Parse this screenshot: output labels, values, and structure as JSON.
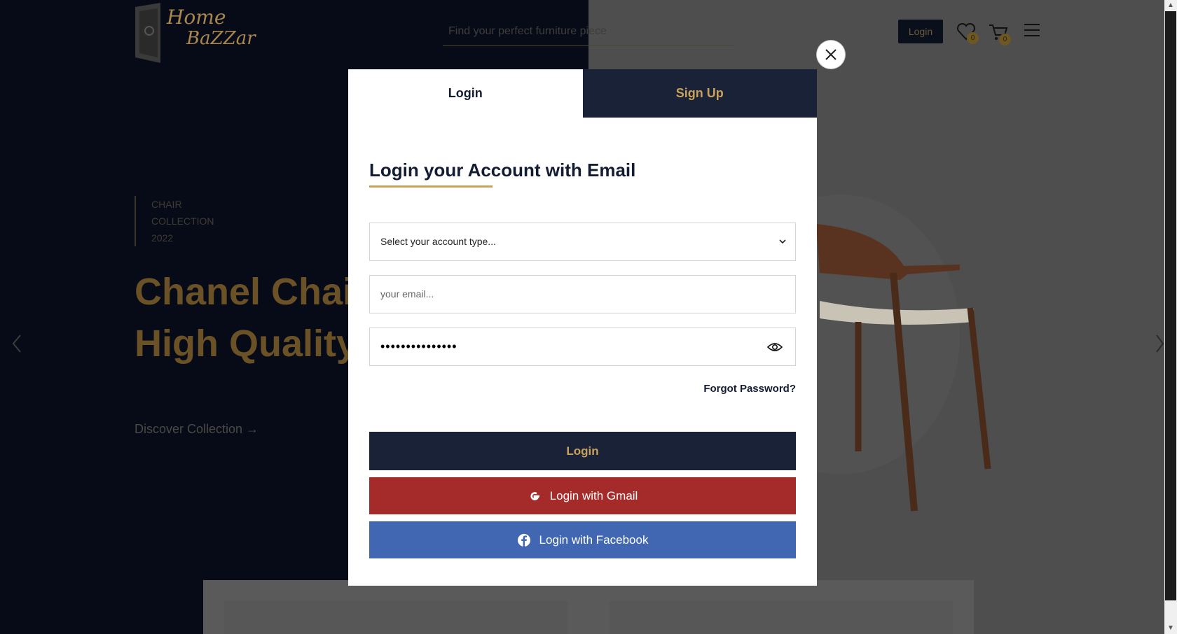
{
  "header": {
    "logo_line1": "Home",
    "logo_line2": "BaZZar",
    "search_placeholder": "Find your perfect furniture piece",
    "login_label": "Login",
    "wishlist_count": "0",
    "cart_count": "0"
  },
  "hero": {
    "tag_line1": "CHAIR",
    "tag_line2": "COLLECTION",
    "tag_line3": "2022",
    "title_line1": "Chanel Chair",
    "title_line2": "High Quality",
    "discover_label": "Discover Collection →"
  },
  "modal": {
    "tabs": [
      {
        "label": "Login",
        "active": true
      },
      {
        "label": "Sign Up",
        "active": false
      }
    ],
    "title": "Login your Account with Email",
    "account_type_placeholder": "Select your account type...",
    "email_placeholder": "your email...",
    "password_masked": "•••••••••••••••",
    "forgot_label": "Forgot Password?",
    "login_button": "Login",
    "gmail_button": "Login with Gmail",
    "facebook_button": "Login with Facebook"
  },
  "colors": {
    "navy": "#1a2238",
    "gold": "#c9a15a",
    "gmail_red": "#a52a2a",
    "facebook_blue": "#4267b2"
  }
}
